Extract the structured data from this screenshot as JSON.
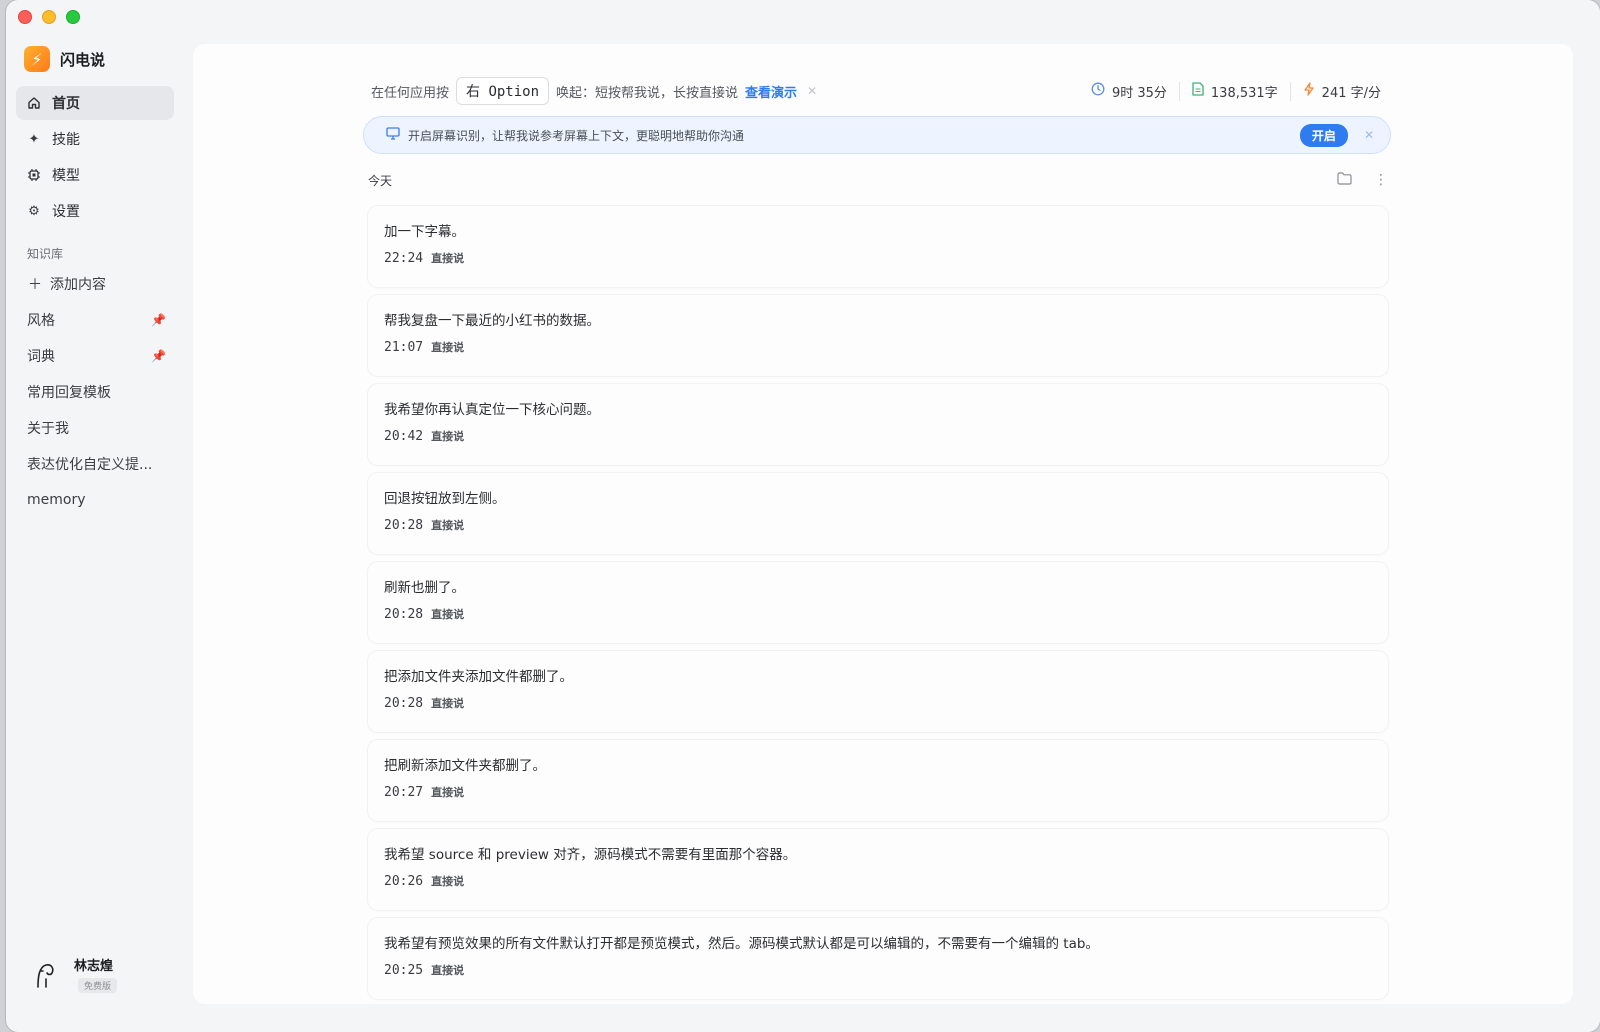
{
  "app": {
    "name": "闪电说",
    "logo_icon": "lightning-bolt-icon",
    "brand_colors": [
      "#ffb02e",
      "#ff7a1a"
    ]
  },
  "nav": [
    {
      "label": "首页",
      "icon": "home-icon",
      "active": true
    },
    {
      "label": "技能",
      "icon": "sparkle-icon",
      "active": false
    },
    {
      "label": "模型",
      "icon": "chip-icon",
      "active": false
    },
    {
      "label": "设置",
      "icon": "gear-icon",
      "active": false
    }
  ],
  "knowledge": {
    "title": "知识库",
    "add_label": "添加内容",
    "items": [
      {
        "label": "风格",
        "pinned": true
      },
      {
        "label": "词典",
        "pinned": true
      },
      {
        "label": "常用回复模板",
        "pinned": false
      },
      {
        "label": "关于我",
        "pinned": false
      },
      {
        "label": "表达优化自定义提...",
        "pinned": false
      },
      {
        "label": "memory",
        "pinned": false
      }
    ]
  },
  "user": {
    "name": "林志煌",
    "plan": "免费版"
  },
  "topbar": {
    "prefix": "在任何应用按",
    "key": "右 Option",
    "hint": "唤起：短按帮我说，长按直接说",
    "demo_link": "查看演示",
    "stats": {
      "duration": "9时 35分",
      "words": "138,531字",
      "speed": "241 字/分"
    }
  },
  "banner": {
    "text": "开启屏幕识别，让帮我说参考屏幕上下文，更聪明地帮助你沟通",
    "button": "开启",
    "accent": "#2f7bf0"
  },
  "history": {
    "day_label": "今天",
    "entries": [
      {
        "text": "加一下字幕。",
        "time": "22:24",
        "mode": "直接说"
      },
      {
        "text": "帮我复盘一下最近的小红书的数据。",
        "time": "21:07",
        "mode": "直接说"
      },
      {
        "text": "我希望你再认真定位一下核心问题。",
        "time": "20:42",
        "mode": "直接说"
      },
      {
        "text": "回退按钮放到左侧。",
        "time": "20:28",
        "mode": "直接说"
      },
      {
        "text": "刷新也删了。",
        "time": "20:28",
        "mode": "直接说"
      },
      {
        "text": "把添加文件夹添加文件都删了。",
        "time": "20:28",
        "mode": "直接说"
      },
      {
        "text": "把刷新添加文件夹都删了。",
        "time": "20:27",
        "mode": "直接说"
      },
      {
        "text": "我希望 source 和 preview 对齐，源码模式不需要有里面那个容器。",
        "time": "20:26",
        "mode": "直接说"
      },
      {
        "text": "我希望有预览效果的所有文件默认打开都是预览模式，然后。源码模式默认都是可以编辑的，不需要有一个编辑的 tab。",
        "time": "20:25",
        "mode": "直接说"
      }
    ]
  }
}
